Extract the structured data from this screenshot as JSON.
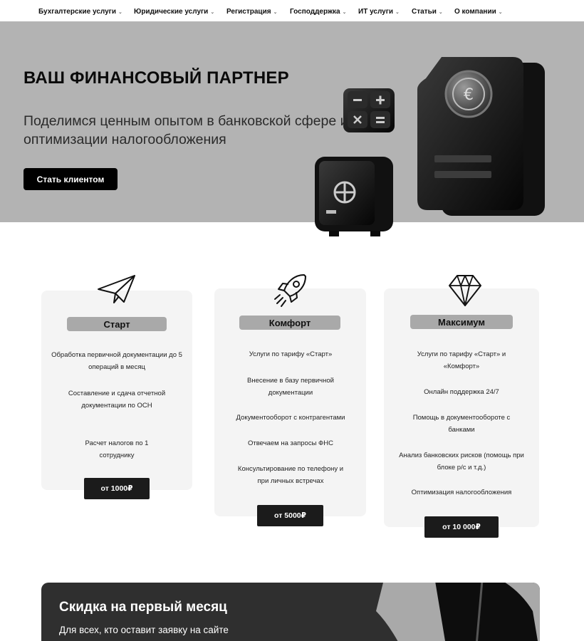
{
  "nav": {
    "items": [
      {
        "label": "Бухгалтерские услуги"
      },
      {
        "label": "Юридические услуги"
      },
      {
        "label": "Регистрация"
      },
      {
        "label": "Господдержка"
      },
      {
        "label": "ИТ услуги"
      },
      {
        "label": "Статьи"
      },
      {
        "label": "О компании"
      }
    ],
    "caret": "⌄"
  },
  "hero": {
    "title": "ВАШ ФИНАНСОВЫЙ ПАРТНЕР",
    "subtitle": "Поделимся ценным опытом в банковской сфере и оптимизации налогообложения",
    "cta": "Стать клиентом"
  },
  "plans": [
    {
      "name": "Старт",
      "icon": "paper-plane-icon",
      "features": [
        "Обработка первичной документации до 5 операций в месяц",
        "Составление и сдача отчетной документации по ОСН",
        "Расчет налогов по 1 сотруднику"
      ],
      "price": "от 1000₽"
    },
    {
      "name": "Комфорт",
      "icon": "rocket-icon",
      "features": [
        "Услуги по тарифу «Старт»",
        "Внесение в базу первичной документации",
        "Документооборот с контрагентами",
        "Отвечаем на запросы ФНС",
        "Консультирование по телефону и при личных встречах"
      ],
      "price": "от 5000₽"
    },
    {
      "name": "Максимум",
      "icon": "diamond-icon",
      "features": [
        "Услуги по тарифу «Старт» и «Комфорт»",
        "Онлайн поддержка 24/7",
        "Помощь в документообороте с банками",
        "Анализ банковских рисков (помощь при блоке р/с и т.д.)",
        "Оптимизация налогообложения"
      ],
      "price": "от 10 000₽"
    }
  ],
  "promo": {
    "title": "Скидка на первый месяц",
    "text": "Для всех, кто оставит заявку на сайте"
  },
  "colors": {
    "hero_bg": "#b3b3b3",
    "card_bg": "#f4f4f4",
    "button_dark": "#1b1b1b",
    "label_gray": "#a9a9a9",
    "promo_bg": "#2f2f2f"
  }
}
